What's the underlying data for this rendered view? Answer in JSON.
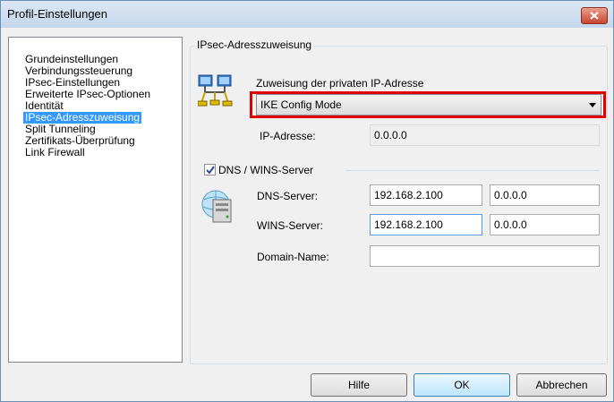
{
  "window": {
    "title": "Profil-Einstellungen"
  },
  "nav": {
    "items": [
      {
        "label": "Grundeinstellungen",
        "selected": false
      },
      {
        "label": "Verbindungssteuerung",
        "selected": false
      },
      {
        "label": "IPsec-Einstellungen",
        "selected": false
      },
      {
        "label": "Erweiterte IPsec-Optionen",
        "selected": false
      },
      {
        "label": "Identität",
        "selected": false
      },
      {
        "label": "IPsec-Adresszuweisung",
        "selected": true
      },
      {
        "label": "Split Tunneling",
        "selected": false
      },
      {
        "label": "Zertifikats-Überprüfung",
        "selected": false
      },
      {
        "label": "Link Firewall",
        "selected": false
      }
    ]
  },
  "section": {
    "title": "IPsec-Adresszuweisung",
    "assignment_label": "Zuweisung der privaten IP-Adresse",
    "assignment_value": "IKE Config Mode",
    "ip_label": "IP-Adresse:",
    "ip_value": "0.0.0.0",
    "dns_wins": {
      "checkbox_label": "DNS / WINS-Server",
      "checked": true,
      "dns_label": "DNS-Server:",
      "dns_primary": "192.168.2.100",
      "dns_secondary": "0.0.0.0",
      "wins_label": "WINS-Server:",
      "wins_primary": "192.168.2.100",
      "wins_secondary": "0.0.0.0",
      "domain_label": "Domain-Name:",
      "domain_value": ""
    }
  },
  "buttons": {
    "help": "Hilfe",
    "ok": "OK",
    "cancel": "Abbrechen"
  },
  "icons": {
    "network": "network-computers-icon",
    "server": "server-icon",
    "close": "close-icon"
  },
  "colors": {
    "highlight_outline": "#e00000",
    "selection": "#3399ff",
    "close_button": "#c9452f"
  }
}
